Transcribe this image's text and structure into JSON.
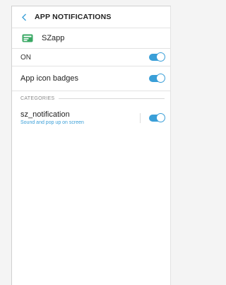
{
  "header": {
    "title": "APP NOTIFICATIONS"
  },
  "app": {
    "name": "SZapp",
    "icon": "app-card-icon"
  },
  "settings": {
    "on": {
      "label": "ON",
      "checked": true
    },
    "badges": {
      "label": "App icon badges",
      "checked": true
    }
  },
  "categories": {
    "label": "CATEGORIES",
    "items": [
      {
        "title": "sz_notification",
        "subtitle": "Sound and pop up on screen",
        "checked": true
      }
    ]
  },
  "colors": {
    "accent": "#3a9fd8",
    "app_icon": "#3aa864"
  }
}
